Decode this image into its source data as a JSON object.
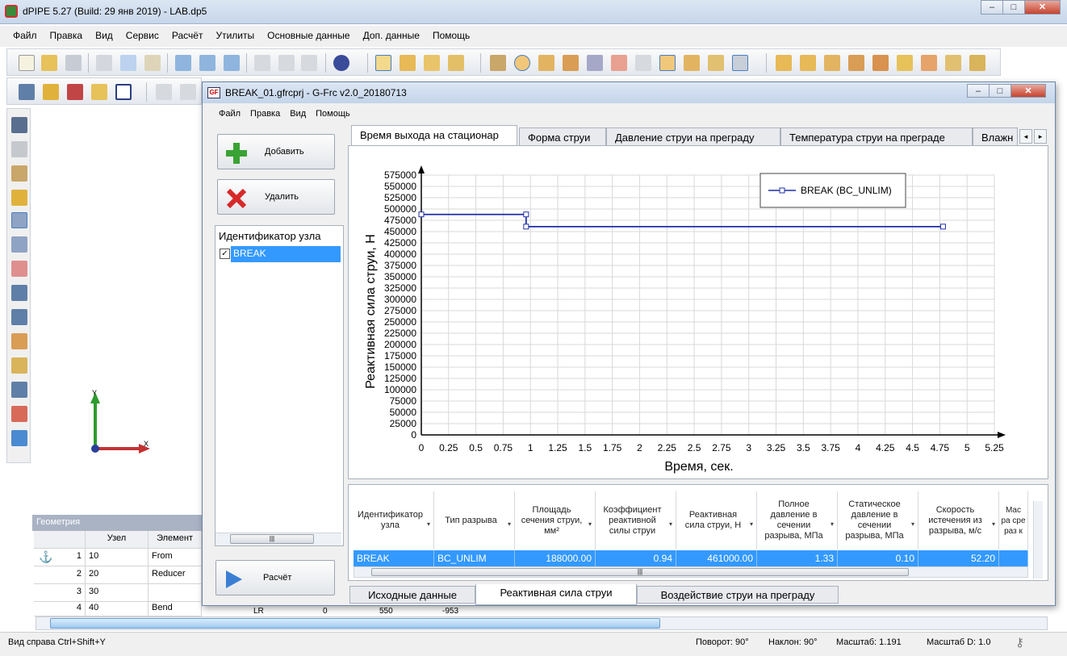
{
  "main_window": {
    "title": "dPIPE 5.27 (Build: 29 янв 2019) - LAB.dp5",
    "menu": [
      "Файл",
      "Правка",
      "Вид",
      "Сервис",
      "Расчёт",
      "Утилиты",
      "Основные данные",
      "Доп. данные",
      "Помощь"
    ],
    "buttons": {
      "minimize": "–",
      "maximize": "□",
      "close": "✕"
    }
  },
  "canvas": {
    "axis_y": "Y",
    "axis_x": "X"
  },
  "geometry": {
    "header": "Геометрия",
    "columns": [
      "",
      "Узел",
      "Элемент"
    ],
    "rows": [
      {
        "n": "1",
        "node": "10",
        "element": "From"
      },
      {
        "n": "2",
        "node": "20",
        "element": "Reducer"
      },
      {
        "n": "3",
        "node": "30",
        "element": ""
      },
      {
        "n": "4",
        "node": "40",
        "element": "Bend"
      }
    ],
    "extra_values": {
      "lr": "LR",
      "zero": "0",
      "v550": "550",
      "vm953": "-953"
    }
  },
  "status": {
    "left": "Вид справа Ctrl+Shift+Y",
    "rotation": "Поворот: 90°",
    "tilt": "Наклон: 90°",
    "scale": "Масштаб: 1.191",
    "scale_d": "Масштаб D: 1.0"
  },
  "child_window": {
    "title": "BREAK_01.gfrcprj - G-Frc v2.0_20180713",
    "icon": "GF",
    "menu": [
      "Файл",
      "Правка",
      "Вид",
      "Помощь"
    ],
    "add_button": "Добавить",
    "delete_button": "Удалить",
    "calc_button": "Расчёт",
    "id_header": "Идентификатор узла",
    "id_items": [
      {
        "label": "BREAK",
        "checked": true
      }
    ],
    "tabs": [
      "Время выхода на стационар",
      "Форма струи",
      "Давление струи на преграду",
      "Температура струи на преграде",
      "Влажн"
    ],
    "active_tab": 0,
    "bottom_tabs": [
      "Исходные данные",
      "Реактивная сила струи",
      "Воздействие струи на преграду"
    ],
    "active_bottom_tab": 1,
    "table": {
      "columns": [
        "Идентификатор узла",
        "Тип разрыва",
        "Площадь сечения струи, мм²",
        "Коэффициент реактивной силы струи",
        "Реактивная сила струи, Н",
        "Полное давление в сечении разрыва, МПа",
        "Статическое давление в сечении разрыва, МПа",
        "Скорость истечения из разрыва, м/с",
        "Мас ра сре раз к"
      ],
      "rows": [
        [
          "BREAK",
          "BC_UNLIM",
          "188000.00",
          "0.94",
          "461000.00",
          "1.33",
          "0.10",
          "52.20",
          ""
        ]
      ]
    }
  },
  "chart_data": {
    "type": "line",
    "title": "",
    "xlabel": "Время, сек.",
    "ylabel": "Реактивная сила струи, Н",
    "xlim": [
      0,
      5.25
    ],
    "ylim": [
      0,
      575000
    ],
    "xticks": [
      "0",
      "0.25",
      "0.5",
      "0.75",
      "1",
      "1.25",
      "1.5",
      "1.75",
      "2",
      "2.25",
      "2.5",
      "2.75",
      "3",
      "3.25",
      "3.5",
      "3.75",
      "4",
      "4.25",
      "4.5",
      "4.75",
      "5",
      "5.25"
    ],
    "yticks": [
      "0",
      "25000",
      "50000",
      "75000",
      "100000",
      "125000",
      "150000",
      "175000",
      "200000",
      "225000",
      "250000",
      "275000",
      "300000",
      "325000",
      "350000",
      "375000",
      "400000",
      "425000",
      "450000",
      "475000",
      "500000",
      "525000",
      "550000",
      "575000"
    ],
    "grid": true,
    "legend": "top-right",
    "series": [
      {
        "name": "BREAK (BC_UNLIM)",
        "color": "#1f2fa8",
        "x": [
          0,
          0.96,
          0.96,
          4.78
        ],
        "y": [
          488000,
          488000,
          461000,
          461000
        ]
      }
    ]
  }
}
